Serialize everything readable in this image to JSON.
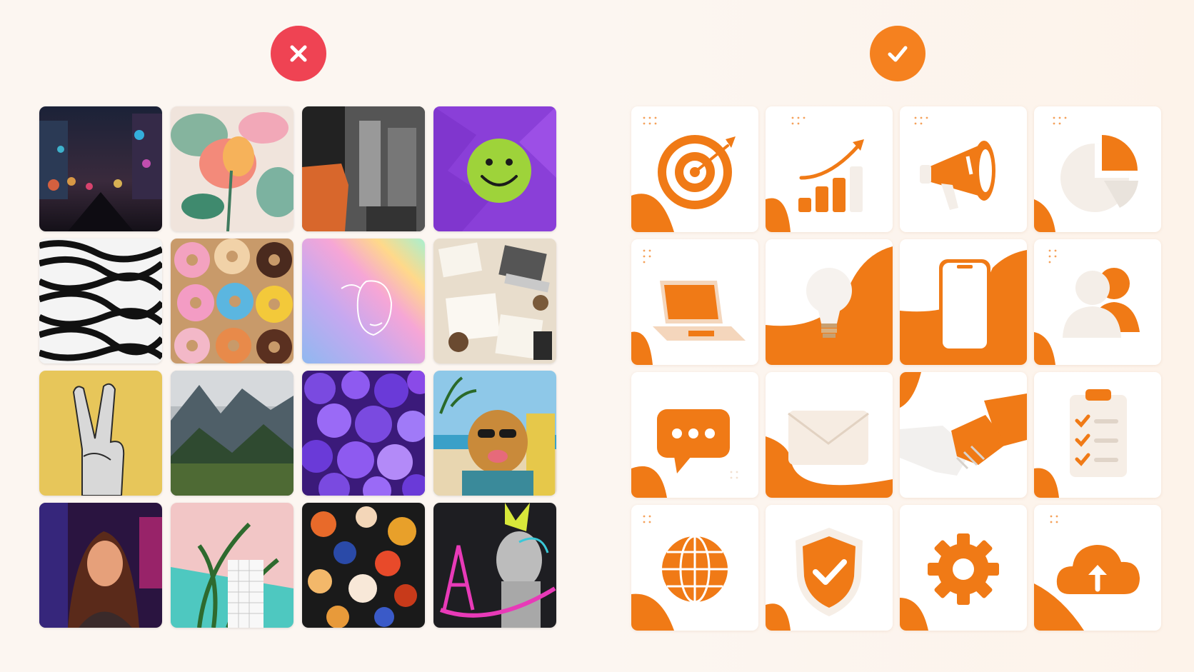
{
  "comparison": {
    "bad_badge_icon": "close-icon",
    "good_badge_icon": "checkmark-icon",
    "colors": {
      "bad": "#ef4353",
      "good": "#f5811f",
      "accent": "#f07a16"
    }
  },
  "left_grid": {
    "tiles": [
      "city-night-bokeh-photo",
      "floral-illustration",
      "bw-collage-torn-paper",
      "smiley-face-purple-paper",
      "op-art-zebra-pattern",
      "donuts-photo",
      "holographic-gradient-face",
      "desk-laptop-papers-photo",
      "halftone-peace-hand",
      "mountain-valley-photo",
      "purple-spheres-3d",
      "dog-sunglasses-beach",
      "neon-woman-portrait",
      "pink-teal-plant-collage",
      "abstract-paint-splatter",
      "statue-graffiti-collage"
    ]
  },
  "right_grid": {
    "tiles": [
      "target-icon",
      "growth-chart-icon",
      "megaphone-icon",
      "pie-chart-icon",
      "laptop-icon",
      "lightbulb-icon",
      "smartphone-icon",
      "users-icon",
      "chat-bubble-icon",
      "envelope-icon",
      "handshake-icon",
      "checklist-icon",
      "globe-icon",
      "shield-check-icon",
      "gear-icon",
      "cloud-upload-icon"
    ]
  }
}
